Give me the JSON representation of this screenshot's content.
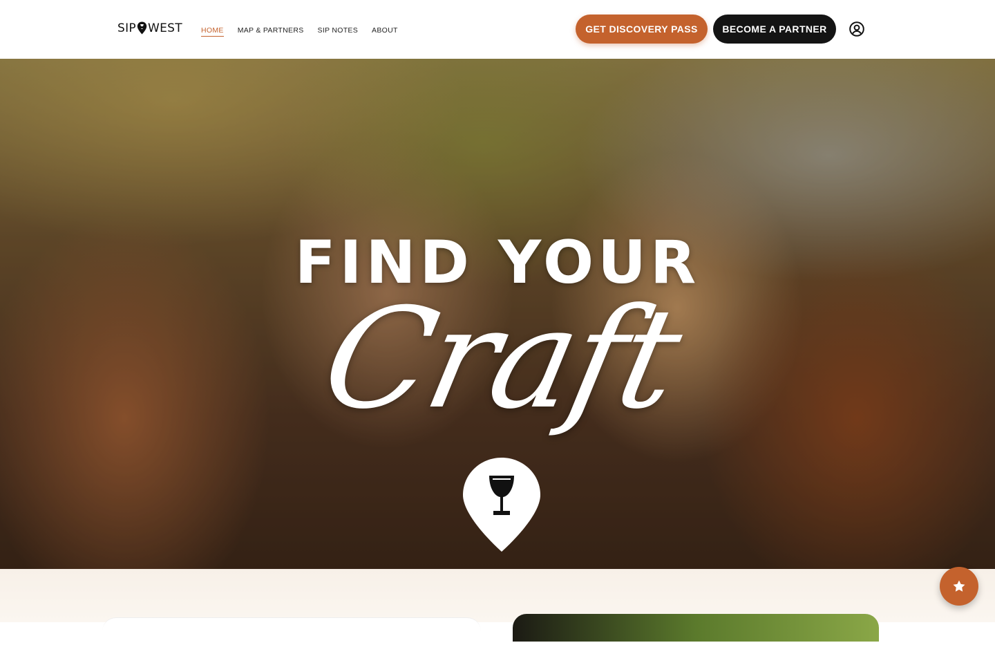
{
  "header": {
    "logo_left": "SIP",
    "logo_right": "WEST",
    "nav": [
      {
        "label": "Home",
        "active": true
      },
      {
        "label": "Map & Partners",
        "active": false
      },
      {
        "label": "Sip Notes",
        "active": false
      },
      {
        "label": "About",
        "active": false
      }
    ],
    "cta_pass": "Get Discovery Pass",
    "cta_partner": "Become a Partner",
    "account_icon": "user-circle-icon"
  },
  "hero": {
    "title": "FIND YOUR",
    "script": "Craft",
    "pin_icon": "glass-pin-icon"
  },
  "fab": {
    "icon": "star-icon"
  },
  "colors": {
    "accent": "#c4622d",
    "dark": "#141414"
  }
}
